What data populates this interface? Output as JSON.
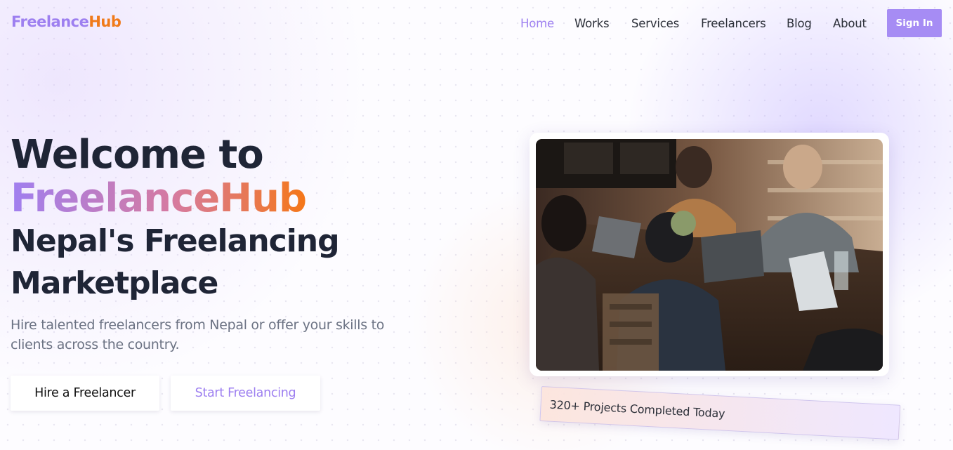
{
  "brand": {
    "name_part1": "Freelance",
    "name_part2": "Hub"
  },
  "nav": {
    "links": [
      "Home",
      "Works",
      "Services",
      "Freelancers",
      "Blog",
      "About"
    ],
    "active": "Home",
    "signin_label": "Sign In"
  },
  "hero": {
    "line1": "Welcome to",
    "line2": "FreelanceHub",
    "line3": "Nepal's Freelancing",
    "line4": "Marketplace",
    "subtitle": "Hire talented freelancers from Nepal or offer your skills to clients across the country.",
    "primary_button": "Hire a Freelancer",
    "secondary_button": "Start Freelancing"
  },
  "stats": {
    "badge_text": "320+ Projects Completed Today"
  },
  "colors": {
    "accent_purple": "#a68cf4",
    "accent_orange": "#f07a1a",
    "heading": "#1f2536",
    "body_text": "#6b7283"
  }
}
